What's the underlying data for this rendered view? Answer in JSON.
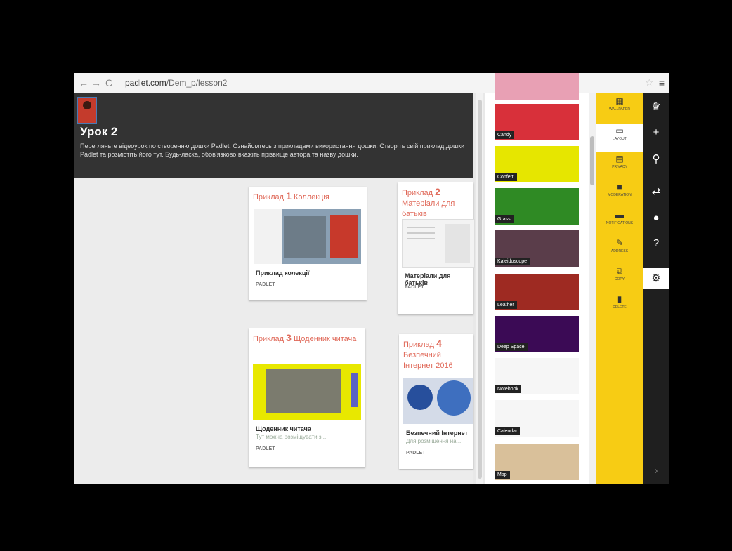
{
  "browser": {
    "back_icon": "arrow-left-icon",
    "url_host": "padlet.com",
    "url_path": "/Dem_p/lesson2",
    "menu_icon": "hamburger-icon"
  },
  "padlet": {
    "title": "Урок 2",
    "description": "Перегляньте відеоурок по створенню дошки Padlet. Ознайомтесь з прикладами використання дошки. Створіть свій приклад дошки Padlet та розмістіть його тут. Будь-ласка, обов'язково вкажіть прізвище автора та назву дошки.",
    "posts": [
      {
        "title_prefix": "Приклад ",
        "num": "1",
        "title_rest": " Коллекція",
        "caption": "Приклад колекції",
        "sub": "",
        "brand": "PADLET"
      },
      {
        "title_prefix": "Приклад ",
        "num": "2",
        "title_rest": " Матеріали для батьків",
        "caption": "Матеріали для батьків",
        "sub": "",
        "brand": "PADLET"
      },
      {
        "title_prefix": "Приклад ",
        "num": "3",
        "title_rest": " Щоденник читача",
        "caption": "Щоденник читача",
        "sub": "Тут можна розміщувати з...",
        "brand": "PADLET"
      },
      {
        "title_prefix": "Приклад ",
        "num": "4",
        "title_rest": " Безпечний Інтернет 2016",
        "caption": "Безпечний Інтернет",
        "sub": "Для розміщення на...",
        "brand": "PADLET"
      }
    ]
  },
  "wallpapers": [
    {
      "label": "",
      "color": "#e8a0b4"
    },
    {
      "label": "Candy",
      "color": "#d8303a"
    },
    {
      "label": "Confetti",
      "color": "#e6e600"
    },
    {
      "label": "Grass",
      "color": "#2f8a24"
    },
    {
      "label": "Kaleidoscope",
      "color": "#5a3d4a"
    },
    {
      "label": "Leather",
      "color": "#9e2a22"
    },
    {
      "label": "Deep Space",
      "color": "#3b0a55"
    },
    {
      "label": "Notebook",
      "color": "#f6f6f6"
    },
    {
      "label": "Calendar",
      "color": "#f6f6f6"
    },
    {
      "label": "Map",
      "color": "#d9c09a"
    }
  ],
  "settings_rail": [
    {
      "icon": "▦",
      "label": "WALLPAPER",
      "name": "wallpaper-icon",
      "active": false
    },
    {
      "icon": "▭",
      "label": "LAYOUT",
      "name": "layout-icon",
      "active": true
    },
    {
      "icon": "▤",
      "label": "PRIVACY",
      "name": "privacy-icon",
      "active": false
    },
    {
      "icon": "■",
      "label": "MODERATION",
      "name": "lock-icon",
      "active": false
    },
    {
      "icon": "▬",
      "label": "NOTIFICATIONS",
      "name": "notifications-icon",
      "active": false
    },
    {
      "icon": "✎",
      "label": "ADDRESS",
      "name": "pencil-icon",
      "active": false
    },
    {
      "icon": "⧉",
      "label": "COPY",
      "name": "copy-icon",
      "active": false
    },
    {
      "icon": "▮",
      "label": "DELETE",
      "name": "trash-icon",
      "active": false
    }
  ],
  "toolbar": [
    {
      "glyph": "♛",
      "name": "crown-icon"
    },
    {
      "glyph": "+",
      "name": "add-icon"
    },
    {
      "glyph": "⚲",
      "name": "user-icon"
    },
    {
      "glyph": "⇄",
      "name": "share-icon"
    },
    {
      "glyph": "●",
      "name": "info-icon"
    },
    {
      "glyph": "?",
      "name": "help-icon"
    },
    {
      "glyph": "⚙",
      "name": "settings-icon"
    },
    {
      "glyph": "›",
      "name": "expand-icon"
    }
  ]
}
